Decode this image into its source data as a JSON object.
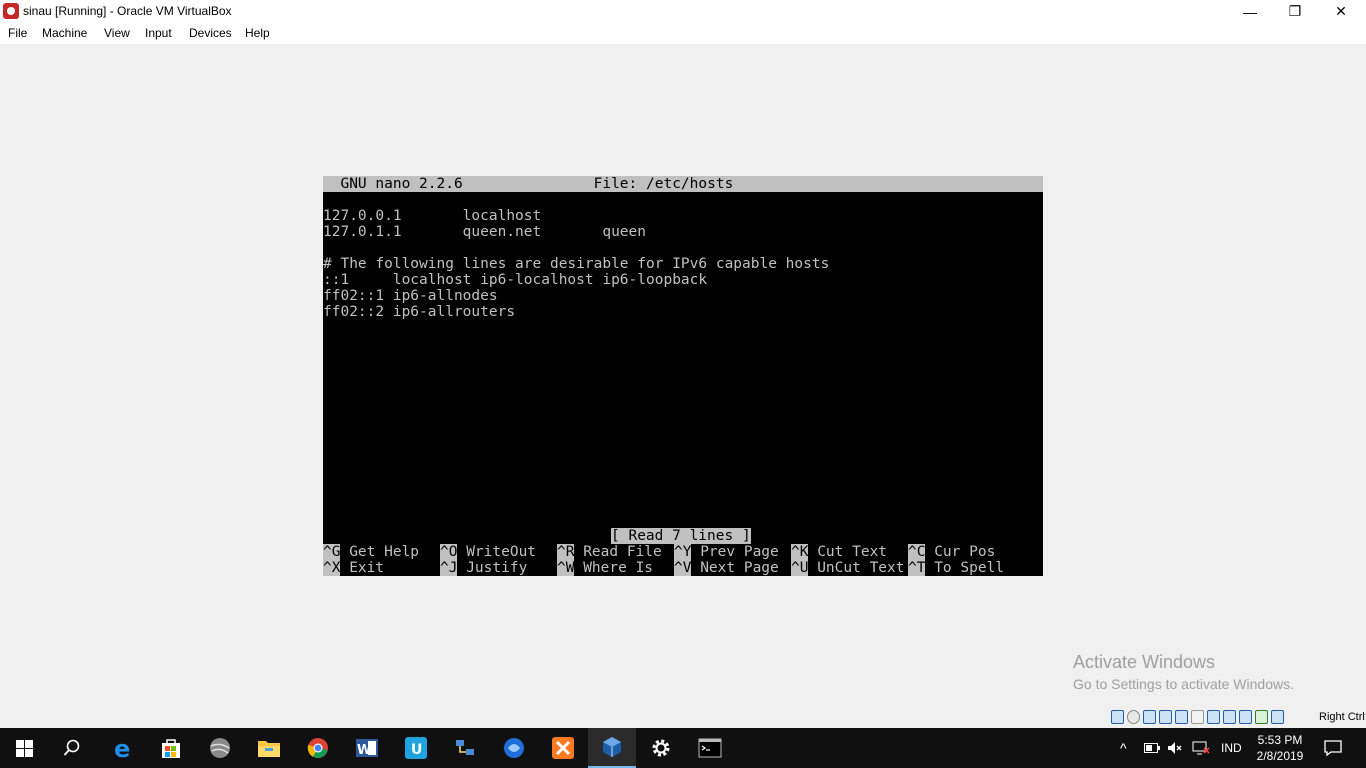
{
  "window": {
    "title": "sinau [Running] - Oracle VM VirtualBox",
    "controls": {
      "minimize": "—",
      "restore": "❐",
      "close": "✕"
    }
  },
  "menu": [
    "File",
    "Machine",
    "View",
    "Input",
    "Devices",
    "Help"
  ],
  "nano": {
    "header": "  GNU nano 2.2.6               File: /etc/hosts                                ",
    "lines": [
      "",
      "127.0.0.1       localhost",
      "127.0.1.1       queen.net       queen",
      "",
      "# The following lines are desirable for IPv6 capable hosts",
      "::1     localhost ip6-localhost ip6-loopback",
      "ff02::1 ip6-allnodes",
      "ff02::2 ip6-allrouters"
    ],
    "status": "[ Read 7 lines ]",
    "shortcuts_row1": [
      {
        "key": "^G",
        "label": " Get Help"
      },
      {
        "key": "^O",
        "label": " WriteOut"
      },
      {
        "key": "^R",
        "label": " Read File"
      },
      {
        "key": "^Y",
        "label": " Prev Page"
      },
      {
        "key": "^K",
        "label": " Cut Text"
      },
      {
        "key": "^C",
        "label": " Cur Pos"
      }
    ],
    "shortcuts_row2": [
      {
        "key": "^X",
        "label": " Exit"
      },
      {
        "key": "^J",
        "label": " Justify"
      },
      {
        "key": "^W",
        "label": " Where Is"
      },
      {
        "key": "^V",
        "label": " Next Page"
      },
      {
        "key": "^U",
        "label": " UnCut Text"
      },
      {
        "key": "^T",
        "label": " To Spell"
      }
    ]
  },
  "watermark": {
    "line1": "Activate Windows",
    "line2": "Go to Settings to activate Windows."
  },
  "vm_status": {
    "icons": [
      "hdd-icon",
      "optical-disk-icon",
      "audio-icon",
      "network-icon",
      "usb-icon",
      "shared-folder-icon",
      "display-icon",
      "video-capture-icon",
      "cpu-icon",
      "mouse-integration-icon",
      "keyboard-capture-icon"
    ],
    "host_key": "Right Ctrl"
  },
  "taskbar": {
    "apps": [
      "start",
      "search",
      "edge",
      "store",
      "app-4",
      "file-explorer",
      "chrome",
      "word",
      "app-8",
      "app-9",
      "app-10",
      "xampp",
      "virtualbox",
      "settings",
      "terminal"
    ],
    "language": "IND",
    "time": "5:53 PM",
    "date": "2/8/2019"
  }
}
